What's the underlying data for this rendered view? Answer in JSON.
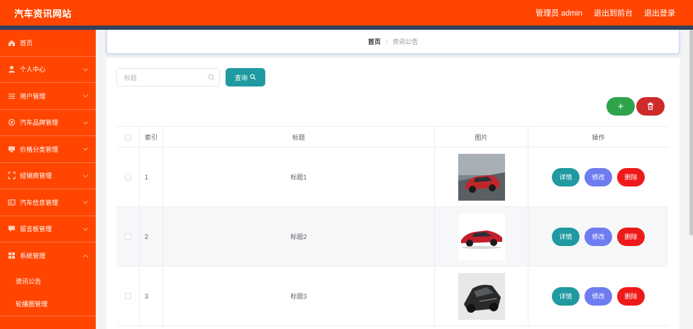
{
  "header": {
    "title": "汽车资讯网站",
    "admin_label": "管理员 admin",
    "back_front": "退出到前台",
    "logout": "退出登录"
  },
  "sidebar": {
    "items": [
      {
        "label": "首页",
        "icon": "home-icon"
      },
      {
        "label": "个人中心",
        "icon": "user-icon"
      },
      {
        "label": "用户管理",
        "icon": "list-icon"
      },
      {
        "label": "汽车品牌管理",
        "icon": "brand-icon"
      },
      {
        "label": "价格分类管理",
        "icon": "monitor-icon"
      },
      {
        "label": "经销商管理",
        "icon": "expand-icon"
      },
      {
        "label": "汽车信息管理",
        "icon": "card-icon"
      },
      {
        "label": "留言板管理",
        "icon": "chat-icon"
      },
      {
        "label": "系统管理",
        "icon": "grid-icon"
      }
    ],
    "sub_items": [
      {
        "label": "资讯公告"
      },
      {
        "label": "轮播图管理"
      }
    ]
  },
  "breadcrumb": {
    "home": "首页",
    "separator": "/",
    "current": "资讯公告"
  },
  "search": {
    "placeholder": "标题",
    "button_label": "查询"
  },
  "actions": {
    "add_symbol": "+"
  },
  "table": {
    "headers": {
      "index": "索引",
      "title": "标题",
      "image": "图片",
      "ops": "操作"
    },
    "rows": [
      {
        "index": "1",
        "title": "标题1",
        "car_color": "#c0262c",
        "image_bg": "#8a8f95"
      },
      {
        "index": "2",
        "title": "标题2",
        "car_color": "#c11f2b",
        "image_bg": "#ffffff"
      },
      {
        "index": "3",
        "title": "标题3",
        "car_color": "#2a2a2a",
        "image_bg": "#e8e8e8"
      }
    ],
    "op_labels": {
      "detail": "详情",
      "edit": "修改",
      "delete": "删除"
    }
  },
  "colors": {
    "primary": "#ff4500",
    "teal": "#1f9aa0",
    "green": "#2fa34a",
    "red": "#ee1a1a",
    "purple": "#6f7cf0"
  }
}
